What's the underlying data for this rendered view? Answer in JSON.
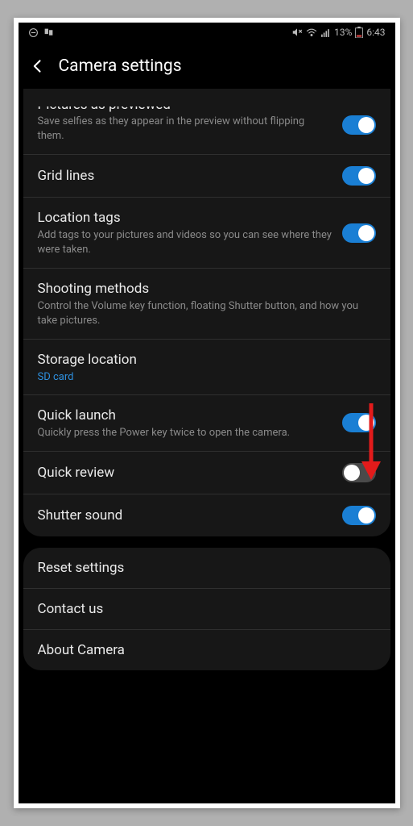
{
  "status": {
    "battery_pct": "13%",
    "time": "6:43"
  },
  "header": {
    "title": "Camera settings"
  },
  "settings": [
    {
      "id": "pictures-as-previewed",
      "title": "Pictures as previewed",
      "subtitle": "Save selfies as they appear in the preview without flipping them.",
      "toggle": true,
      "cutoff": true
    },
    {
      "id": "grid-lines",
      "title": "Grid lines",
      "subtitle": "",
      "toggle": true
    },
    {
      "id": "location-tags",
      "title": "Location tags",
      "subtitle": "Add tags to your pictures and videos so you can see where they were taken.",
      "toggle": true
    },
    {
      "id": "shooting-methods",
      "title": "Shooting methods",
      "subtitle": "Control the Volume key function, floating Shutter button, and how you take pictures.",
      "toggle": null
    },
    {
      "id": "storage-location",
      "title": "Storage location",
      "value": "SD card",
      "toggle": null
    },
    {
      "id": "quick-launch",
      "title": "Quick launch",
      "subtitle": "Quickly press the Power key twice to open the camera.",
      "toggle": true
    },
    {
      "id": "quick-review",
      "title": "Quick review",
      "subtitle": "",
      "toggle": false
    },
    {
      "id": "shutter-sound",
      "title": "Shutter sound",
      "subtitle": "",
      "toggle": true
    }
  ],
  "footer": [
    {
      "id": "reset",
      "label": "Reset settings"
    },
    {
      "id": "contact",
      "label": "Contact us"
    },
    {
      "id": "about",
      "label": "About Camera"
    }
  ]
}
